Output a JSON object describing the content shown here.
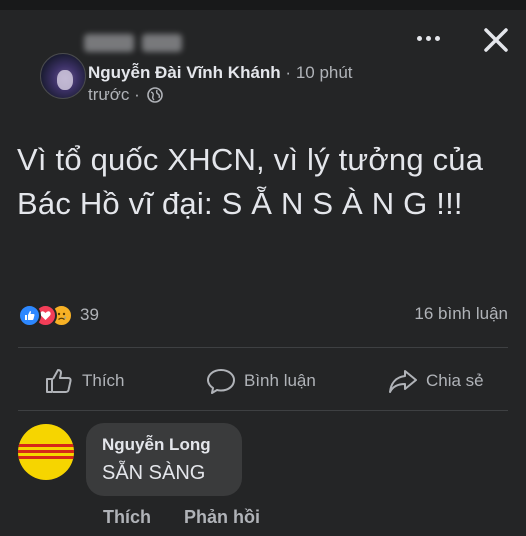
{
  "post": {
    "author": "Nguyễn Đài Vĩnh Khánh",
    "time_part1": "10 phút",
    "time_part2": "trước",
    "separator": "·",
    "privacy_icon": "globe-icon",
    "text": "Vì tổ quốc XHCN, vì lý tưởng của Bác Hồ vĩ đại: S Ẵ N S À N G !!!",
    "reactions": {
      "types": [
        "like",
        "love",
        "sad"
      ],
      "count": "39"
    },
    "comment_count": "16 bình luận"
  },
  "actions": {
    "like": "Thích",
    "comment": "Bình luận",
    "share": "Chia sẻ"
  },
  "comment": {
    "author": "Nguyễn Long",
    "text": "SẴN SÀNG",
    "like": "Thích",
    "reply": "Phản hồi"
  },
  "colors": {
    "background": "#242526",
    "bubble": "#3a3b3c",
    "text": "#e4e6eb",
    "secondary_text": "#b0b3b8",
    "like_blue": "#2d88ff",
    "love_red": "#f33e58",
    "sad_yellow": "#f7b125",
    "flag_yellow": "#f6d500",
    "flag_red": "#d62718"
  }
}
